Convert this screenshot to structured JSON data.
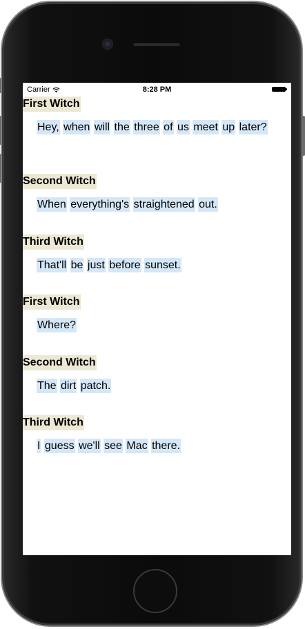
{
  "status_bar": {
    "carrier": "Carrier",
    "time": "8:28 PM",
    "icons": [
      "wifi-icon",
      "battery-icon"
    ]
  },
  "dialogue": [
    {
      "speaker": "First Witch",
      "line": "Hey, when will the three of us meet up later?"
    },
    {
      "speaker": "Second Witch",
      "line": "When everything's straightened out."
    },
    {
      "speaker": "Third Witch",
      "line": "That'll be just before sunset."
    },
    {
      "speaker": "First Witch",
      "line": "Where?"
    },
    {
      "speaker": "Second Witch",
      "line": "The dirt patch."
    },
    {
      "speaker": "Third Witch",
      "line": "I guess we'll see Mac there."
    }
  ],
  "colors": {
    "speaker_highlight": "#ece8d3",
    "word_highlight": "#d5e7f7",
    "device_body": "#0b0b0b"
  }
}
